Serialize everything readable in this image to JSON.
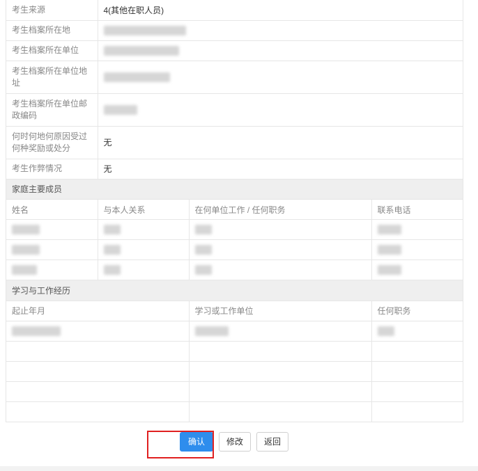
{
  "info_rows": [
    {
      "label": "考生来源",
      "value": "4(其他在职人员)"
    },
    {
      "label": "考生档案所在地",
      "value": ""
    },
    {
      "label": "考生档案所在单位",
      "value": ""
    },
    {
      "label": "考生档案所在单位地址",
      "value": ""
    },
    {
      "label": "考生档案所在单位邮政编码",
      "value": ""
    },
    {
      "label": "何时何地何原因受过何种奖励或处分",
      "value": "无"
    },
    {
      "label": "考生作弊情况",
      "value": "无"
    }
  ],
  "family": {
    "section_title": "家庭主要成员",
    "headers": [
      "姓名",
      "与本人关系",
      "在何单位工作 / 任何职务",
      "联系电话"
    ]
  },
  "experience": {
    "section_title": "学习与工作经历",
    "headers": [
      "起止年月",
      "学习或工作单位",
      "任何职务"
    ]
  },
  "buttons": {
    "confirm": "确认",
    "modify": "修改",
    "back": "返回"
  },
  "colors": {
    "primary": "#2e8ded",
    "highlight": "#e02020"
  }
}
